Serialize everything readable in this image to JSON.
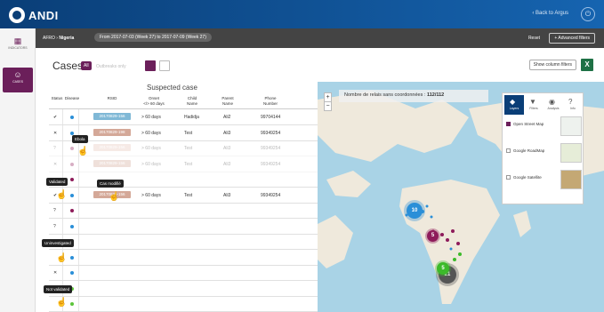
{
  "app": {
    "name": "ANDI",
    "back_link": "‹ Back to Argus",
    "power_icon": "power-icon"
  },
  "sidebar": {
    "items": [
      {
        "label": "INDICATORS",
        "icon": "grid-icon"
      },
      {
        "label": "CASES",
        "icon": "people-icon"
      }
    ]
  },
  "filterbar": {
    "region": "AFRO",
    "country": "Nigeria",
    "date_range": "From 2017-07-03 (Week 27) to 2017-07-09 (Week 27)",
    "reset_label": "Reset",
    "advanced_label": "+ Advanced filters"
  },
  "cases": {
    "title": "Cases",
    "all_label": "All",
    "outbreaks_label": "Outbreaks only",
    "show_columns_label": "Show column filters",
    "excel_label": "X"
  },
  "table": {
    "group_header": "Suspected case",
    "headers": {
      "status": "Status",
      "disease": "Disease",
      "rsid": "RSID",
      "onset": "Onset\n</> 60 days",
      "child": "Child\nName",
      "parent": "Parent\nName",
      "phone": "Phone\nNumber"
    },
    "rows": [
      {
        "status": "✔",
        "disease_color": "#2a8fd8",
        "rsid": "20170829-156",
        "rsid_color": "#7fb8d6",
        "onset": "> 60 days",
        "child": "Hadidja",
        "parent": "Ali2",
        "phone": "99704144",
        "faded": false
      },
      {
        "status": "✕",
        "disease_color": "#2a8fd8",
        "rsid": "20170829-198",
        "rsid_color": "#d4a898",
        "onset": "> 60 days",
        "child": "Test",
        "parent": "Ali3",
        "phone": "99349254",
        "faded": false
      },
      {
        "status": "?",
        "disease_color": "#8e1b5a",
        "rsid": "20170829-156",
        "rsid_color": "#e8c4b8",
        "onset": "> 60 days",
        "child": "Test",
        "parent": "Ali3",
        "phone": "99349254",
        "faded": true
      },
      {
        "status": "✕",
        "disease_color": "#8e1b5a",
        "rsid": "20170829-156",
        "rsid_color": "#d4a898",
        "onset": "> 60 days",
        "child": "Test",
        "parent": "Ali3",
        "phone": "99349254",
        "faded": true
      },
      {
        "status": "",
        "disease_color": "#8e1b5a",
        "rsid": "",
        "rsid_color": "",
        "onset": "",
        "child": "",
        "parent": "",
        "phone": "",
        "faded": false
      },
      {
        "status": "✔",
        "disease_color": "#2a8fd8",
        "rsid": "20170829-156",
        "rsid_color": "#d4a898",
        "onset": "> 60 days",
        "child": "Test",
        "parent": "Ali3",
        "phone": "99349254",
        "faded": false
      },
      {
        "status": "?",
        "disease_color": "#8e1b5a",
        "rsid": "",
        "rsid_color": "",
        "onset": "",
        "child": "",
        "parent": "",
        "phone": "",
        "faded": false
      },
      {
        "status": "?",
        "disease_color": "#2a8fd8",
        "rsid": "",
        "rsid_color": "",
        "onset": "",
        "child": "",
        "parent": "",
        "phone": "",
        "faded": false
      },
      {
        "status": "",
        "disease_color": "#5cc43a",
        "rsid": "",
        "rsid_color": "",
        "onset": "",
        "child": "",
        "parent": "",
        "phone": "",
        "faded": false
      },
      {
        "status": "",
        "disease_color": "#2a8fd8",
        "rsid": "",
        "rsid_color": "",
        "onset": "",
        "child": "",
        "parent": "",
        "phone": "",
        "faded": false
      },
      {
        "status": "✕",
        "disease_color": "#2a8fd8",
        "rsid": "",
        "rsid_color": "",
        "onset": "",
        "child": "",
        "parent": "",
        "phone": "",
        "faded": false
      },
      {
        "status": "",
        "disease_color": "#5cc43a",
        "rsid": "",
        "rsid_color": "",
        "onset": "",
        "child": "",
        "parent": "",
        "phone": "",
        "faded": false
      },
      {
        "status": "",
        "disease_color": "#5cc43a",
        "rsid": "",
        "rsid_color": "",
        "onset": "",
        "child": "",
        "parent": "",
        "phone": "",
        "faded": false
      }
    ]
  },
  "tooltips": {
    "ebola": "Ebola",
    "validated": "Validated",
    "case_modified": "Cas modifié",
    "uninvestigated": "Uninvestigated",
    "not_validated": "Not validated"
  },
  "map": {
    "zoom_in": "+",
    "zoom_out": "−",
    "no_coords_label": "Nombre de relais sans coordonnées :",
    "no_coords_value": "112/112",
    "layer_tabs": [
      {
        "label": "Layers",
        "icon": "layers-icon"
      },
      {
        "label": "Filters",
        "icon": "filter-icon"
      },
      {
        "label": "Analysis",
        "icon": "analysis-icon"
      },
      {
        "label": "Info",
        "icon": "info-icon"
      }
    ],
    "layers": [
      {
        "label": "Open Street Map",
        "selected": true
      },
      {
        "label": "Google RoadMap",
        "selected": false
      },
      {
        "label": "Google Satellite",
        "selected": false
      }
    ],
    "clusters": [
      {
        "count": "10",
        "color": "#2a8fd8"
      },
      {
        "count": "5",
        "color": "#8e1b5a"
      },
      {
        "count": "21",
        "color": "#555555"
      },
      {
        "count": "5",
        "color": "#3cba2a"
      }
    ]
  }
}
